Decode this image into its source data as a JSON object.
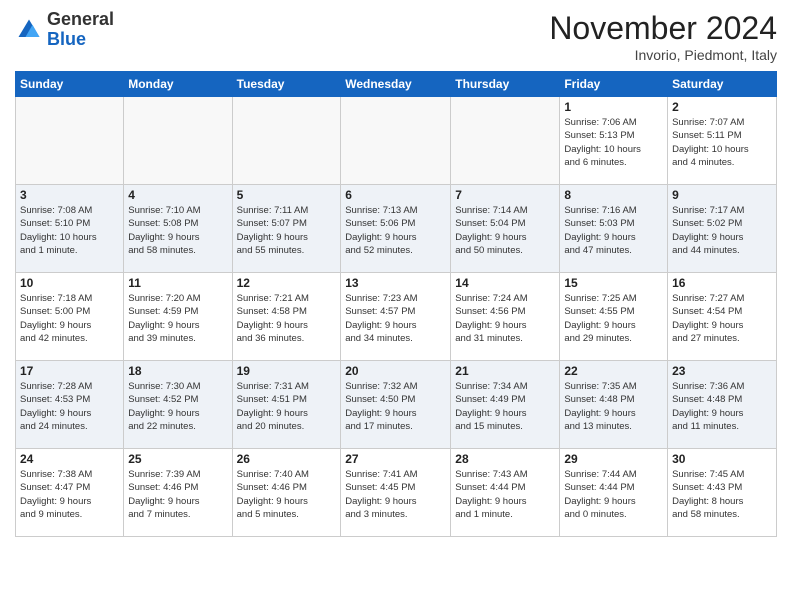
{
  "logo": {
    "general": "General",
    "blue": "Blue"
  },
  "header": {
    "title": "November 2024",
    "location": "Invorio, Piedmont, Italy"
  },
  "weekdays": [
    "Sunday",
    "Monday",
    "Tuesday",
    "Wednesday",
    "Thursday",
    "Friday",
    "Saturday"
  ],
  "weeks": [
    [
      {
        "day": "",
        "info": ""
      },
      {
        "day": "",
        "info": ""
      },
      {
        "day": "",
        "info": ""
      },
      {
        "day": "",
        "info": ""
      },
      {
        "day": "",
        "info": ""
      },
      {
        "day": "1",
        "info": "Sunrise: 7:06 AM\nSunset: 5:13 PM\nDaylight: 10 hours\nand 6 minutes."
      },
      {
        "day": "2",
        "info": "Sunrise: 7:07 AM\nSunset: 5:11 PM\nDaylight: 10 hours\nand 4 minutes."
      }
    ],
    [
      {
        "day": "3",
        "info": "Sunrise: 7:08 AM\nSunset: 5:10 PM\nDaylight: 10 hours\nand 1 minute."
      },
      {
        "day": "4",
        "info": "Sunrise: 7:10 AM\nSunset: 5:08 PM\nDaylight: 9 hours\nand 58 minutes."
      },
      {
        "day": "5",
        "info": "Sunrise: 7:11 AM\nSunset: 5:07 PM\nDaylight: 9 hours\nand 55 minutes."
      },
      {
        "day": "6",
        "info": "Sunrise: 7:13 AM\nSunset: 5:06 PM\nDaylight: 9 hours\nand 52 minutes."
      },
      {
        "day": "7",
        "info": "Sunrise: 7:14 AM\nSunset: 5:04 PM\nDaylight: 9 hours\nand 50 minutes."
      },
      {
        "day": "8",
        "info": "Sunrise: 7:16 AM\nSunset: 5:03 PM\nDaylight: 9 hours\nand 47 minutes."
      },
      {
        "day": "9",
        "info": "Sunrise: 7:17 AM\nSunset: 5:02 PM\nDaylight: 9 hours\nand 44 minutes."
      }
    ],
    [
      {
        "day": "10",
        "info": "Sunrise: 7:18 AM\nSunset: 5:00 PM\nDaylight: 9 hours\nand 42 minutes."
      },
      {
        "day": "11",
        "info": "Sunrise: 7:20 AM\nSunset: 4:59 PM\nDaylight: 9 hours\nand 39 minutes."
      },
      {
        "day": "12",
        "info": "Sunrise: 7:21 AM\nSunset: 4:58 PM\nDaylight: 9 hours\nand 36 minutes."
      },
      {
        "day": "13",
        "info": "Sunrise: 7:23 AM\nSunset: 4:57 PM\nDaylight: 9 hours\nand 34 minutes."
      },
      {
        "day": "14",
        "info": "Sunrise: 7:24 AM\nSunset: 4:56 PM\nDaylight: 9 hours\nand 31 minutes."
      },
      {
        "day": "15",
        "info": "Sunrise: 7:25 AM\nSunset: 4:55 PM\nDaylight: 9 hours\nand 29 minutes."
      },
      {
        "day": "16",
        "info": "Sunrise: 7:27 AM\nSunset: 4:54 PM\nDaylight: 9 hours\nand 27 minutes."
      }
    ],
    [
      {
        "day": "17",
        "info": "Sunrise: 7:28 AM\nSunset: 4:53 PM\nDaylight: 9 hours\nand 24 minutes."
      },
      {
        "day": "18",
        "info": "Sunrise: 7:30 AM\nSunset: 4:52 PM\nDaylight: 9 hours\nand 22 minutes."
      },
      {
        "day": "19",
        "info": "Sunrise: 7:31 AM\nSunset: 4:51 PM\nDaylight: 9 hours\nand 20 minutes."
      },
      {
        "day": "20",
        "info": "Sunrise: 7:32 AM\nSunset: 4:50 PM\nDaylight: 9 hours\nand 17 minutes."
      },
      {
        "day": "21",
        "info": "Sunrise: 7:34 AM\nSunset: 4:49 PM\nDaylight: 9 hours\nand 15 minutes."
      },
      {
        "day": "22",
        "info": "Sunrise: 7:35 AM\nSunset: 4:48 PM\nDaylight: 9 hours\nand 13 minutes."
      },
      {
        "day": "23",
        "info": "Sunrise: 7:36 AM\nSunset: 4:48 PM\nDaylight: 9 hours\nand 11 minutes."
      }
    ],
    [
      {
        "day": "24",
        "info": "Sunrise: 7:38 AM\nSunset: 4:47 PM\nDaylight: 9 hours\nand 9 minutes."
      },
      {
        "day": "25",
        "info": "Sunrise: 7:39 AM\nSunset: 4:46 PM\nDaylight: 9 hours\nand 7 minutes."
      },
      {
        "day": "26",
        "info": "Sunrise: 7:40 AM\nSunset: 4:46 PM\nDaylight: 9 hours\nand 5 minutes."
      },
      {
        "day": "27",
        "info": "Sunrise: 7:41 AM\nSunset: 4:45 PM\nDaylight: 9 hours\nand 3 minutes."
      },
      {
        "day": "28",
        "info": "Sunrise: 7:43 AM\nSunset: 4:44 PM\nDaylight: 9 hours\nand 1 minute."
      },
      {
        "day": "29",
        "info": "Sunrise: 7:44 AM\nSunset: 4:44 PM\nDaylight: 9 hours\nand 0 minutes."
      },
      {
        "day": "30",
        "info": "Sunrise: 7:45 AM\nSunset: 4:43 PM\nDaylight: 8 hours\nand 58 minutes."
      }
    ]
  ]
}
